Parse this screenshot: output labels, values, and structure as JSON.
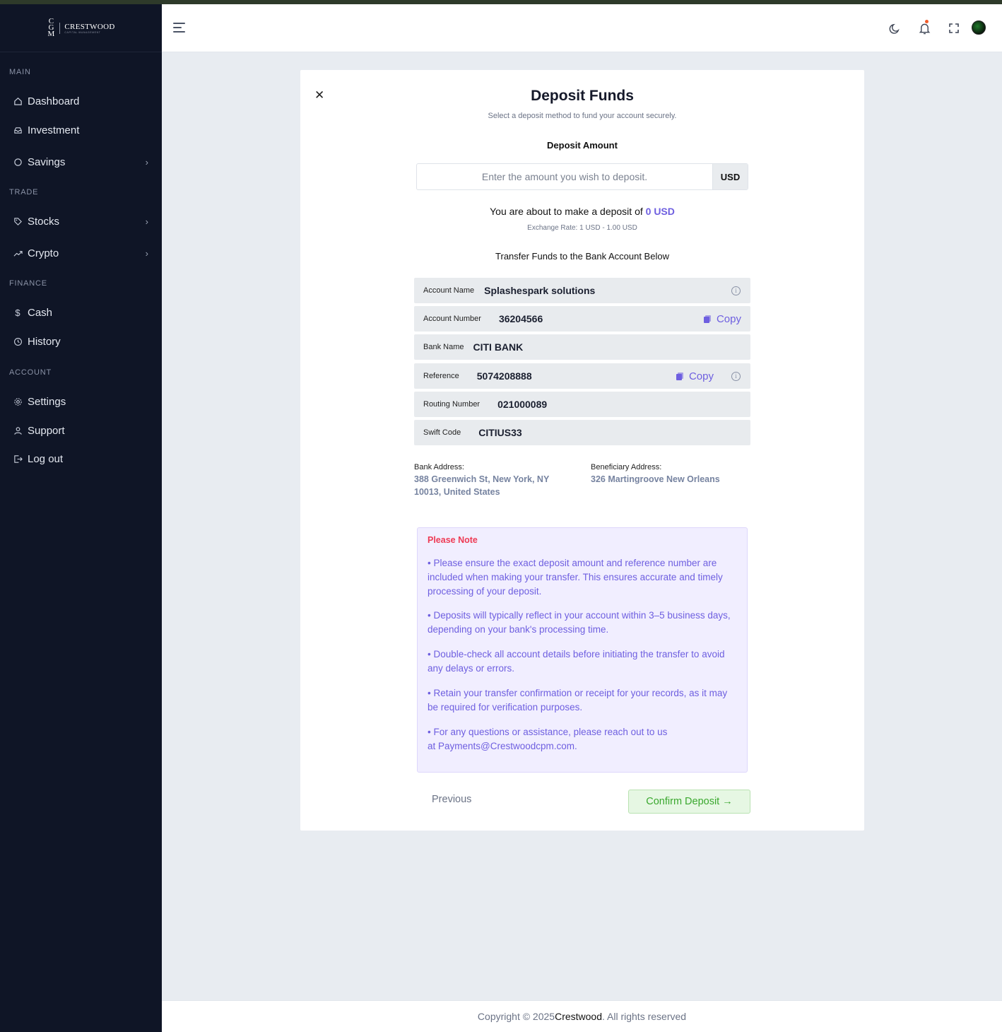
{
  "brand": {
    "mark": "C G M",
    "name": "CRESTWOOD",
    "sub": "CAPITAL MANAGEMENT"
  },
  "sidebar": {
    "sections": [
      {
        "label": "MAIN"
      },
      {
        "label": "TRADE"
      },
      {
        "label": "FINANCE"
      },
      {
        "label": "ACCOUNT"
      }
    ],
    "items": [
      {
        "label": "Dashboard",
        "icon": "home-icon"
      },
      {
        "label": "Investment",
        "icon": "inbox-icon"
      },
      {
        "label": "Savings",
        "icon": "circle-icon"
      },
      {
        "label": "Stocks",
        "icon": "tag-icon"
      },
      {
        "label": "Crypto",
        "icon": "trending-up-icon"
      },
      {
        "label": "Cash",
        "icon": "dollar-icon"
      },
      {
        "label": "History",
        "icon": "clock-icon"
      },
      {
        "label": "Settings",
        "icon": "gear-icon"
      },
      {
        "label": "Support",
        "icon": "user-icon"
      },
      {
        "label": "Log out",
        "icon": "logout-icon"
      }
    ]
  },
  "modal": {
    "title": "Deposit Funds",
    "subtitle": "Select a deposit method to fund your account securely.",
    "amount_label": "Deposit Amount",
    "amount_placeholder": "Enter the amount you wish to deposit.",
    "amount_value": "",
    "currency": "USD",
    "about_prefix": "You are about to make a deposit of",
    "about_amount": "0 USD",
    "exchange_rate": "Exchange Rate: 1 USD - 1.00 USD",
    "transfer_heading": "Transfer Funds to the Bank Account Below",
    "account": {
      "name_label": "Account Name",
      "name_value": "Splashespark solutions",
      "number_label": "Account Number",
      "number_value": "36204566",
      "bank_label": "Bank Name",
      "bank_value": "CITI BANK",
      "reference_label": "Reference",
      "reference_value": "5074208888",
      "routing_label": "Routing Number",
      "routing_value": "021000089",
      "swift_label": "Swift Code",
      "swift_value": "CITIUS33",
      "copy_label": "Copy"
    },
    "bank_address_label": "Bank Address:",
    "bank_address": "388 Greenwich St, New York, NY 10013, United States",
    "beneficiary_address_label": "Beneficiary Address:",
    "beneficiary_address": "326 Martingroove New Orleans",
    "note_title": "Please Note",
    "notes": [
      "• Please ensure the exact deposit amount and reference number are included when making your transfer. This ensures accurate and timely processing of your deposit.",
      "• Deposits will typically reflect in your account within 3–5 business days, depending on your bank's processing time.",
      "• Double-check all account details before initiating the transfer to avoid any delays or errors.",
      "• Retain your transfer confirmation or receipt for your records, as it may be required for verification purposes.",
      "• For any questions or assistance, please reach out to us at Payments@Crestwoodcpm.com."
    ],
    "prev_label": "Previous",
    "confirm_label": "Confirm Deposit",
    "confirm_arrow": "→"
  },
  "footer": {
    "prefix": "Copyright © 2025 ",
    "brand": "Crestwood",
    "suffix": ". All rights reserved"
  },
  "colors": {
    "sidebar_bg": "#0f1526",
    "accent": "#6e5fe0",
    "note_title": "#ee3a54",
    "confirm_text": "#3aa82e"
  }
}
